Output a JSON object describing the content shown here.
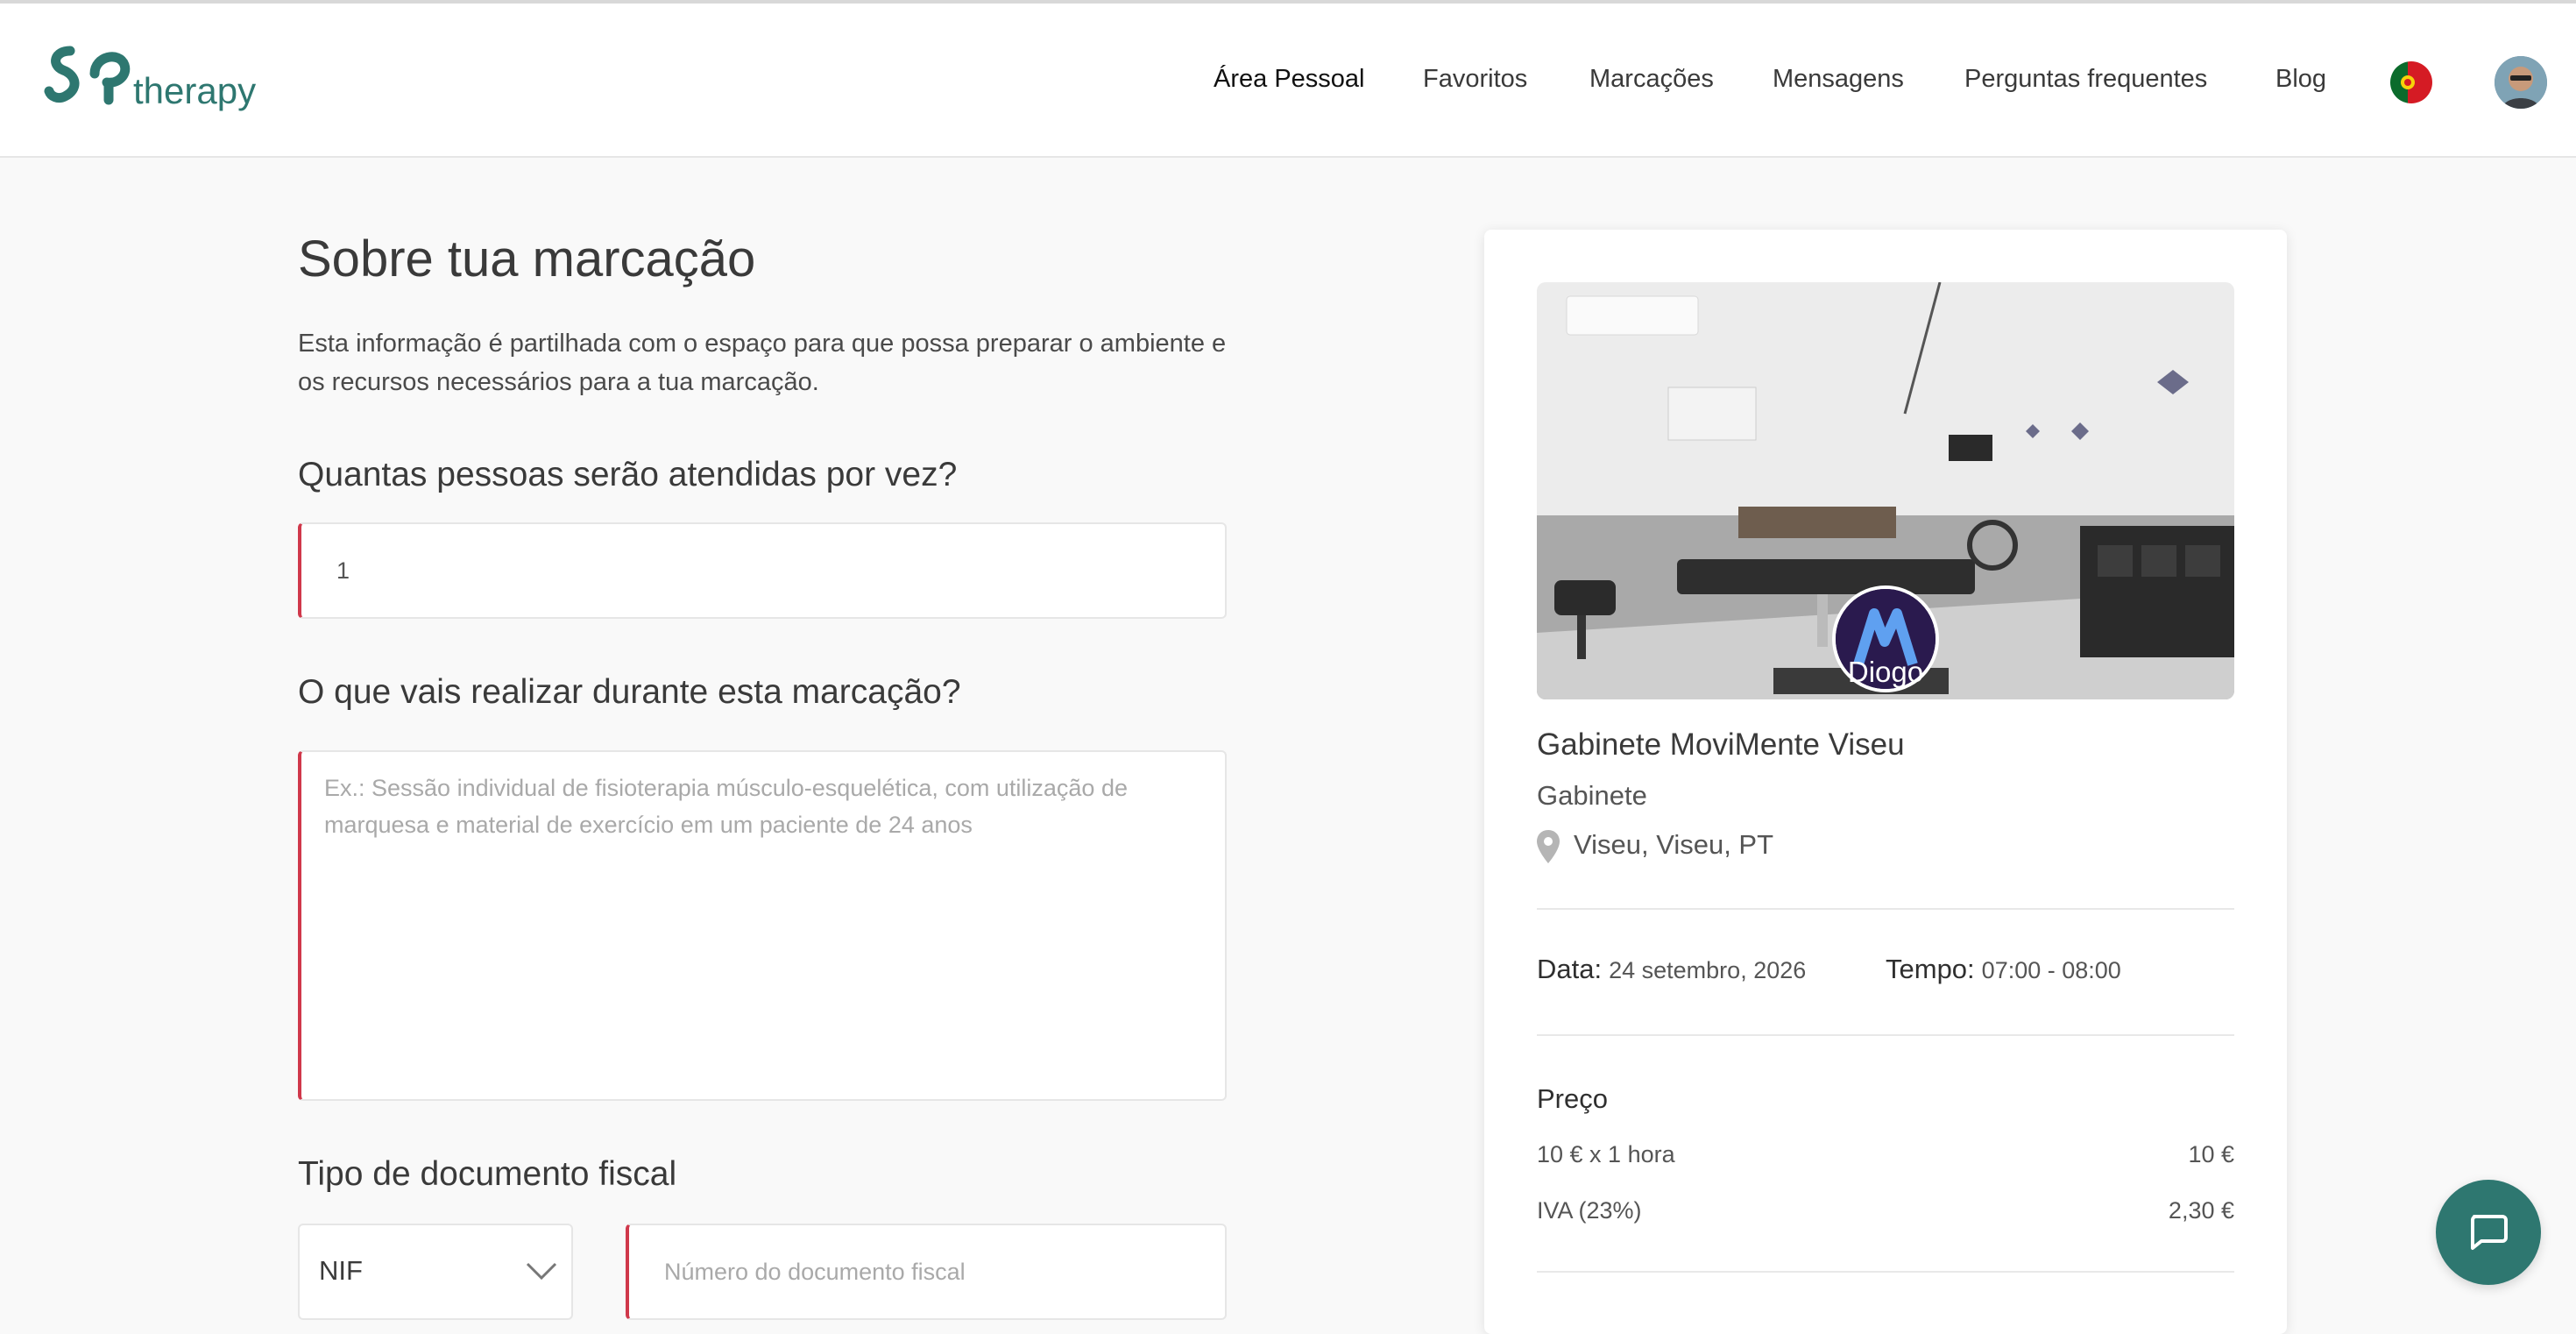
{
  "brand": {
    "logo_text": "therapy",
    "logo_mark": "SP",
    "color": "#2e7770"
  },
  "nav": {
    "items": [
      {
        "label": "Área Pessoal",
        "active": true
      },
      {
        "label": "Favoritos"
      },
      {
        "label": "Marcações"
      },
      {
        "label": "Mensagens"
      },
      {
        "label": "Perguntas frequentes"
      },
      {
        "label": "Blog"
      }
    ],
    "language_icon": "portugal-flag-icon",
    "profile_icon": "user-avatar"
  },
  "form": {
    "title": "Sobre tua marcação",
    "description": "Esta informação é partilhada com o espaço para que possa preparar o ambiente e os recursos necessários para a tua marcação.",
    "people_question": "Quantas pessoas serão atendidas por vez?",
    "people_value": "1",
    "activity_question": "O que vais realizar durante esta marcação?",
    "activity_placeholder": "Ex.: Sessão individual de fisioterapia músculo-esquelética, com utilização de marquesa e material de exercício em um paciente de 24 anos",
    "fiscal_title": "Tipo de documento fiscal",
    "fiscal_type": "NIF",
    "fiscal_placeholder": "Número do documento fiscal",
    "error_color": "#d0384b"
  },
  "booking": {
    "professional_name": "Diogo",
    "venue_name": "Gabinete MoviMente Viseu",
    "venue_type": "Gabinete",
    "location": "Viseu, Viseu, PT",
    "date_label": "Data:",
    "date_value": "24 setembro, 2026",
    "time_label": "Tempo:",
    "time_value": "07:00 - 08:00",
    "price_title": "Preço",
    "price_lines": [
      {
        "label": "10 € x 1 hora",
        "value": "10 €"
      },
      {
        "label": "IVA (23%)",
        "value": "2,30 €"
      }
    ]
  },
  "chat": {
    "icon": "chat-bubble-icon"
  }
}
